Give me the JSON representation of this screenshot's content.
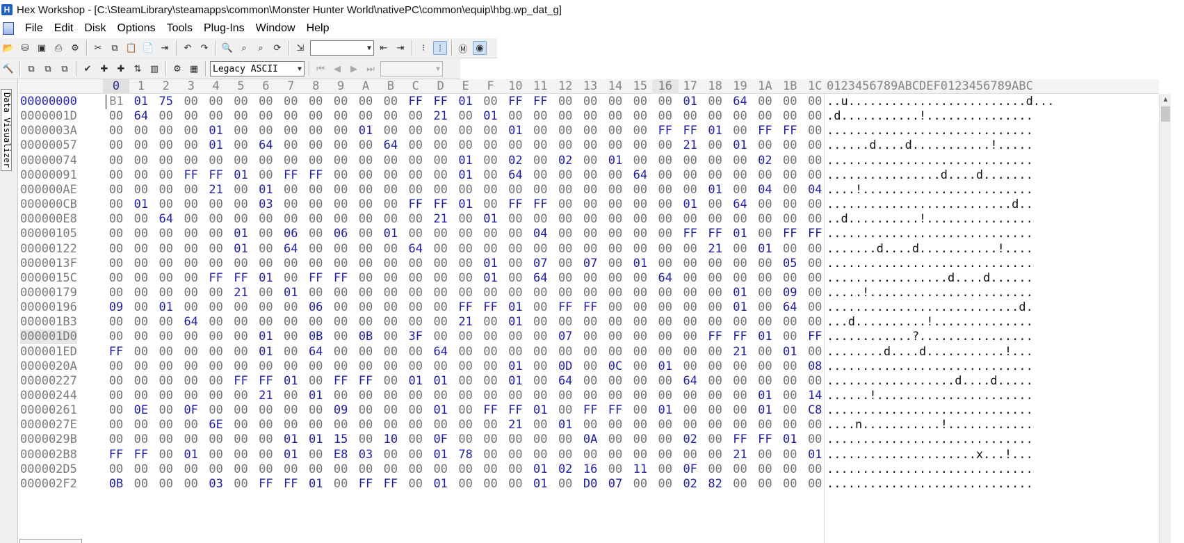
{
  "window": {
    "title": "Hex Workshop - [C:\\SteamLibrary\\steamapps\\common\\Monster Hunter World\\nativePC\\common\\equip\\hbg.wp_dat_g]",
    "app_icon": "H"
  },
  "menu": [
    "File",
    "Edit",
    "Disk",
    "Options",
    "Tools",
    "Plug-Ins",
    "Window",
    "Help"
  ],
  "toolbar1": {
    "goto_value": ""
  },
  "toolbar2": {
    "encoding_selected": "Legacy ASCII",
    "record_value": ""
  },
  "side_tab": {
    "label": "Data Visualizer"
  },
  "hex": {
    "column_headers": [
      "0",
      "1",
      "2",
      "3",
      "4",
      "5",
      "6",
      "7",
      "8",
      "9",
      "A",
      "B",
      "C",
      "D",
      "E",
      "F",
      "10",
      "11",
      "12",
      "13",
      "14",
      "15",
      "16",
      "17",
      "18",
      "19",
      "1A",
      "1B",
      "1C"
    ],
    "ascii_header": "0123456789ABCDEF0123456789ABC",
    "rows": [
      {
        "offset": "00000000",
        "bytes": "B1 01 75 00 00 00 00 00 00 00 00 00 FF FF 01 00 FF FF 00 00 00 00 00 01 00 64 00 00 00",
        "ascii": "..u.........................d..."
      },
      {
        "offset": "0000001D",
        "bytes": "00 64 00 00 00 00 00 00 00 00 00 00 00 21 00 01 00 00 00 00 00 00 00 00 00 00 00 00 00",
        "ascii": ".d...........!..............."
      },
      {
        "offset": "0000003A",
        "bytes": "00 00 00 00 01 00 00 00 00 00 01 00 00 00 00 00 01 00 00 00 00 00 FF FF 01 00 FF FF 00",
        "ascii": "............................."
      },
      {
        "offset": "00000057",
        "bytes": "00 00 00 00 01 00 64 00 00 00 00 64 00 00 00 00 00 00 00 00 00 00 00 21 00 01 00 00 00",
        "ascii": "......d....d...........!....."
      },
      {
        "offset": "00000074",
        "bytes": "00 00 00 00 00 00 00 00 00 00 00 00 00 00 01 00 02 00 02 00 01 00 00 00 00 00 02 00 00",
        "ascii": "............................."
      },
      {
        "offset": "00000091",
        "bytes": "00 00 00 FF FF 01 00 FF FF 00 00 00 00 00 01 00 64 00 00 00 00 64 00 00 00 00 00 00 00",
        "ascii": "................d....d......."
      },
      {
        "offset": "000000AE",
        "bytes": "00 00 00 00 21 00 01 00 00 00 00 00 00 00 00 00 00 00 00 00 00 00 00 00 01 00 04 00 04",
        "ascii": "....!........................"
      },
      {
        "offset": "000000CB",
        "bytes": "00 01 00 00 00 00 03 00 00 00 00 00 FF FF 01 00 FF FF 00 00 00 00 00 01 00 64 00 00 00",
        "ascii": "..........................d.."
      },
      {
        "offset": "000000E8",
        "bytes": "00 00 64 00 00 00 00 00 00 00 00 00 00 21 00 01 00 00 00 00 00 00 00 00 00 00 00 00 00",
        "ascii": "..d..........!..............."
      },
      {
        "offset": "00000105",
        "bytes": "00 00 00 00 00 01 00 06 00 06 00 01 00 00 00 00 00 04 00 00 00 00 00 FF FF 01 00 FF FF",
        "ascii": "............................."
      },
      {
        "offset": "00000122",
        "bytes": "00 00 00 00 00 01 00 64 00 00 00 00 64 00 00 00 00 00 00 00 00 00 00 00 21 00 01 00 00",
        "ascii": ".......d....d...........!...."
      },
      {
        "offset": "0000013F",
        "bytes": "00 00 00 00 00 00 00 00 00 00 00 00 00 00 00 01 00 07 00 07 00 01 00 00 00 00 00 05 00",
        "ascii": "............................."
      },
      {
        "offset": "0000015C",
        "bytes": "00 00 00 00 FF FF 01 00 FF FF 00 00 00 00 00 01 00 64 00 00 00 00 64 00 00 00 00 00 00",
        "ascii": ".................d....d......"
      },
      {
        "offset": "00000179",
        "bytes": "00 00 00 00 00 21 00 01 00 00 00 00 00 00 00 00 00 00 00 00 00 00 00 00 00 01 00 09 00",
        "ascii": ".....!......................."
      },
      {
        "offset": "00000196",
        "bytes": "09 00 01 00 00 00 00 00 06 00 00 00 00 00 FF FF 01 00 FF FF 00 00 00 00 00 01 00 64 00",
        "ascii": "...........................d."
      },
      {
        "offset": "000001B3",
        "bytes": "00 00 00 64 00 00 00 00 00 00 00 00 00 00 21 00 01 00 00 00 00 00 00 00 00 00 00 00 00",
        "ascii": "...d..........!.............."
      },
      {
        "offset": "000001D0",
        "bytes": "00 00 00 00 00 00 01 00 0B 00 0B 00 3F 00 00 00 00 00 07 00 00 00 00 00 FF FF 01 00 FF",
        "ascii": "............?................"
      },
      {
        "offset": "000001ED",
        "bytes": "FF 00 00 00 00 00 01 00 64 00 00 00 00 64 00 00 00 00 00 00 00 00 00 00 00 21 00 01 00",
        "ascii": "........d....d...........!..."
      },
      {
        "offset": "0000020A",
        "bytes": "00 00 00 00 00 00 00 00 00 00 00 00 00 00 00 00 01 00 0D 00 0C 00 01 00 00 00 00 00 08",
        "ascii": "............................."
      },
      {
        "offset": "00000227",
        "bytes": "00 00 00 00 00 FF FF 01 00 FF FF 00 01 01 00 00 01 00 64 00 00 00 00 64 00 00 00 00 00",
        "ascii": "..................d....d....."
      },
      {
        "offset": "00000244",
        "bytes": "00 00 00 00 00 00 21 00 01 00 00 00 00 00 00 00 00 00 00 00 00 00 00 00 00 00 01 00 14",
        "ascii": "......!......................"
      },
      {
        "offset": "00000261",
        "bytes": "00 0E 00 0F 00 00 00 00 00 09 00 00 00 01 00 FF FF 01 00 FF FF 00 01 00 00 00 01 00 C8",
        "ascii": "............................."
      },
      {
        "offset": "0000027E",
        "bytes": "00 00 00 00 6E 00 00 00 00 00 00 00 00 00 00 00 21 00 01 00 00 00 00 00 00 00 00 00 00",
        "ascii": "....n...........!............"
      },
      {
        "offset": "0000029B",
        "bytes": "00 00 00 00 00 00 00 01 01 15 00 10 00 0F 00 00 00 00 00 0A 00 00 00 02 00 FF FF 01 00",
        "ascii": "............................."
      },
      {
        "offset": "000002B8",
        "bytes": "FF FF 00 01 00 00 00 01 00 E8 03 00 00 01 78 00 00 00 00 00 00 00 00 00 00 21 00 00 01",
        "ascii": ".....................x...!..."
      },
      {
        "offset": "000002D5",
        "bytes": "00 00 00 00 00 00 00 00 00 00 00 00 00 00 00 00 00 01 02 16 00 11 00 0F 00 00 00 00 00",
        "ascii": "............................."
      },
      {
        "offset": "000002F2",
        "bytes": "0B 00 00 00 03 00 FF FF 01 00 FF FF 00 01 00 00 00 01 00 D0 07 00 00 02 82 00 00 00 00",
        "ascii": "............................."
      }
    ]
  },
  "colors": {
    "nonzero_byte": "#1f1fa0",
    "zero_byte": "#727272",
    "offset": "#7b7b7b"
  }
}
